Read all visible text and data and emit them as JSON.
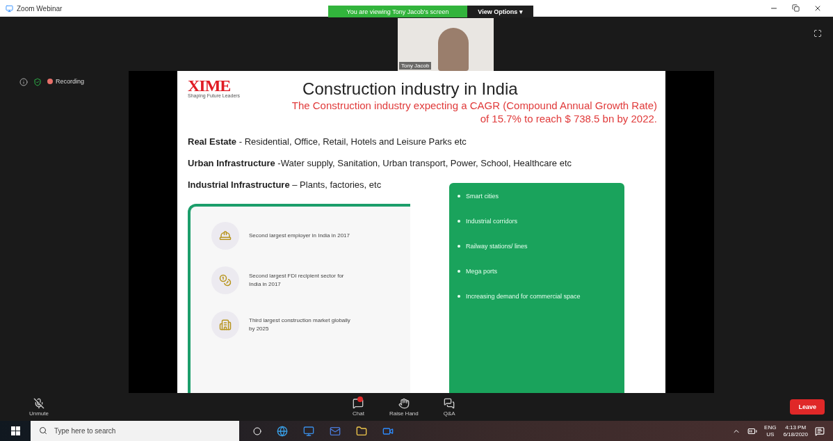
{
  "window": {
    "title": "Zoom Webinar",
    "share_banner": "You are viewing Tony Jacob's screen",
    "view_options": "View Options ▾"
  },
  "video": {
    "name": "Tony Jacob"
  },
  "recording": {
    "label": "Recording"
  },
  "slide": {
    "logo": "XIME",
    "logo_tagline": "Shaping Future Leaders",
    "title": "Construction industry in India",
    "subtitle": [
      "The Construction industry expecting a CAGR (Compound Annual Growth Rate)",
      "of 15.7% to reach $ 738.5 bn by 2022."
    ],
    "sectors": [
      "**Real Estate** - Residential, Office, Retail, Hotels and Leisure Parks etc",
      "**Urban Infrastructure** -Water supply, Sanitation, Urban transport, Power, School, Healthcare etc",
      "**Industrial Infrastructure** – Plants, factories, etc"
    ],
    "highlights": [
      {
        "kind": "workers",
        "text": "Second largest employer in India in 2017"
      },
      {
        "kind": "money",
        "text": "Second largest FDI recipient sector for India in 2017"
      },
      {
        "kind": "building",
        "text": "Third largest construction market globally by 2025"
      }
    ],
    "opportunities": [
      "Smart cities",
      "Industrial corridors",
      "Railway stations/ lines",
      "Mega ports",
      "Increasing demand for commercial space"
    ]
  },
  "controls": [
    {
      "kind": "mic",
      "label": "Unmute",
      "badge": false
    },
    {
      "kind": "chat",
      "label": "Chat",
      "badge": true
    },
    {
      "kind": "hand",
      "label": "Raise Hand",
      "badge": false
    },
    {
      "kind": "qa",
      "label": "Q&A",
      "badge": false
    }
  ],
  "leave": "Leave",
  "taskbar": {
    "search_placeholder": "Type here to search",
    "lang": [
      "ENG",
      "US"
    ],
    "time": "4:13 PM",
    "date": "6/18/2020"
  }
}
